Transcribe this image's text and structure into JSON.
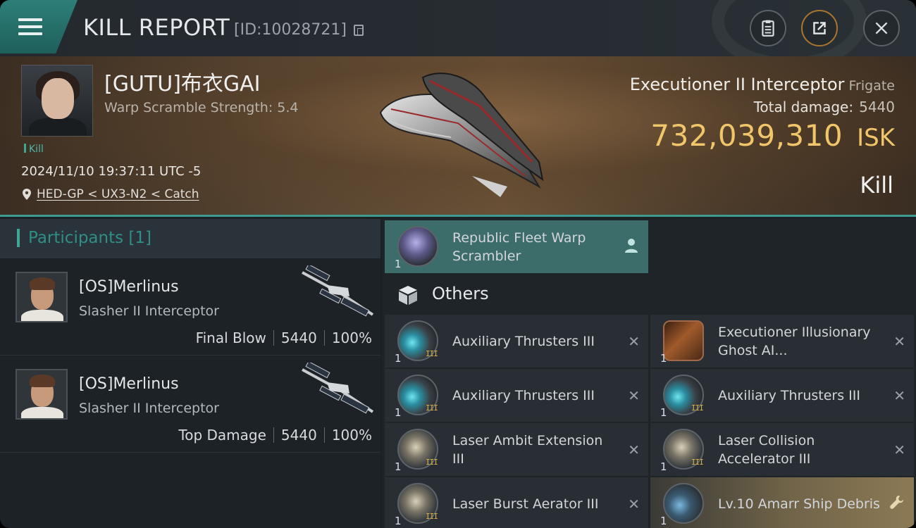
{
  "header": {
    "title": "KILL REPORT",
    "kill_id": "[ID:10028721]",
    "buttons": [
      "clipboard-icon",
      "share-icon",
      "close-icon"
    ]
  },
  "victim": {
    "name": "[GUTU]布衣GAI",
    "warp_scramble": "Warp Scramble Strength: 5.4",
    "tag": "Kill",
    "datetime": "2024/11/10 19:37:11 UTC -5",
    "location": "HED-GP < UX3-N2 < Catch"
  },
  "ship": {
    "name": "Executioner II Interceptor",
    "class": "Frigate",
    "total_damage_label": "Total damage:",
    "total_damage": "5440",
    "isk_value": "732,039,310",
    "isk_unit": "ISK",
    "result": "Kill"
  },
  "participants": {
    "title": "Participants",
    "count": "[1]",
    "list": [
      {
        "name": "[OS]Merlinus",
        "ship": "Slasher II Interceptor",
        "role": "Final Blow",
        "damage": "5440",
        "percent": "100%"
      },
      {
        "name": "[OS]Merlinus",
        "ship": "Slasher II Interceptor",
        "role": "Top Damage",
        "damage": "5440",
        "percent": "100%"
      }
    ]
  },
  "items": {
    "featured": {
      "name": "Republic Fleet Warp Scrambler",
      "qty": "1"
    },
    "others_label": "Others",
    "list": [
      {
        "name": "Auxiliary Thrusters III",
        "qty": "1",
        "grade": "III"
      },
      {
        "name": "Executioner Illusionary Ghost AI...",
        "qty": "1",
        "grade": ""
      },
      {
        "name": "Auxiliary Thrusters III",
        "qty": "1",
        "grade": "III"
      },
      {
        "name": "Auxiliary Thrusters III",
        "qty": "1",
        "grade": "III"
      },
      {
        "name": "Laser Ambit Extension III",
        "qty": "1",
        "grade": "III"
      },
      {
        "name": "Laser Collision Accelerator III",
        "qty": "1",
        "grade": "III"
      },
      {
        "name": "Laser Burst Aerator III",
        "qty": "1",
        "grade": "III"
      },
      {
        "name": "Lv.10 Amarr Ship Debris",
        "qty": "1",
        "grade": ""
      }
    ]
  },
  "colors": {
    "accent": "#3fa595",
    "isk": "#f1c56a",
    "highlight": "#3c6d6a"
  }
}
